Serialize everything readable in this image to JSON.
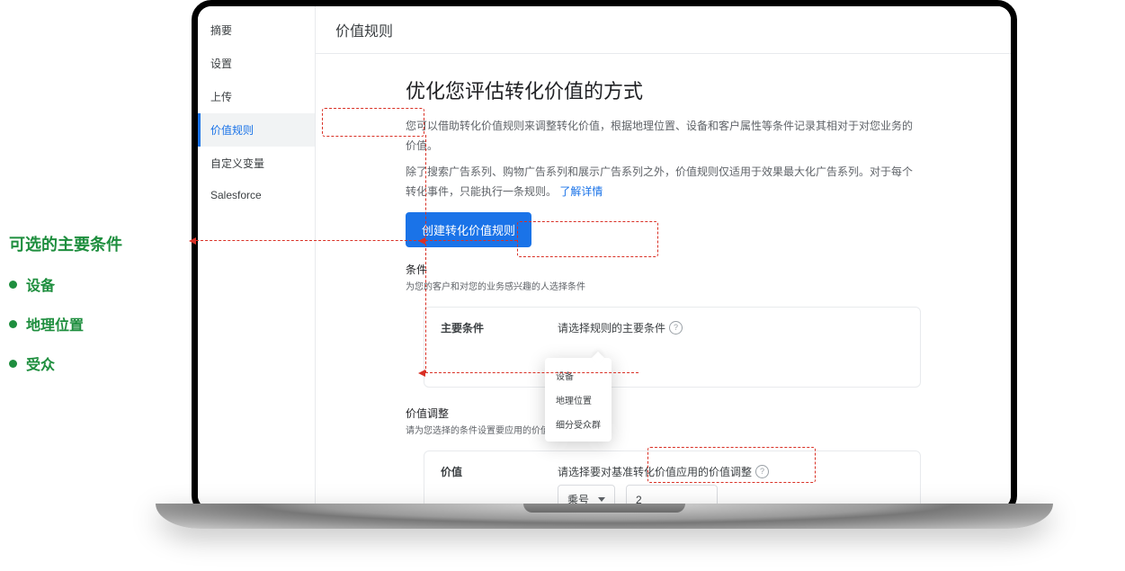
{
  "annotation": {
    "title": "可选的主要条件",
    "items": [
      "设备",
      "地理位置",
      "受众"
    ]
  },
  "sidebar": {
    "items": [
      {
        "label": "摘要"
      },
      {
        "label": "设置"
      },
      {
        "label": "上传"
      },
      {
        "label": "价值规则",
        "selected": true
      },
      {
        "label": "自定义变量"
      },
      {
        "label": "Salesforce"
      }
    ]
  },
  "header": {
    "title": "价值规则"
  },
  "hero": {
    "title": "优化您评估转化价值的方式",
    "p1": "您可以借助转化价值规则来调整转化价值，根据地理位置、设备和客户属性等条件记录其相对于对您业务的价值。",
    "p2": "除了搜索广告系列、购物广告系列和展示广告系列之外，价值规则仅适用于效果最大化广告系列。对于每个转化事件，只能执行一条规则。",
    "learn_more": "了解详情",
    "primary_button": "创建转化价值规则"
  },
  "conditions": {
    "section_title": "条件",
    "section_sub": "为您的客户和对您的业务感兴趣的人选择条件",
    "main_label": "主要条件",
    "field_label": "请选择规则的主要条件",
    "menu": {
      "items": [
        "设备",
        "地理位置",
        "细分受众群"
      ]
    }
  },
  "value_adjust": {
    "section_title": "价值调整",
    "section_sub": "请为您选择的条件设置要应用的价值",
    "value_label": "价值",
    "field_label": "请选择要对基准转化价值应用的价值调整",
    "operator": "乘号",
    "number": "2"
  }
}
